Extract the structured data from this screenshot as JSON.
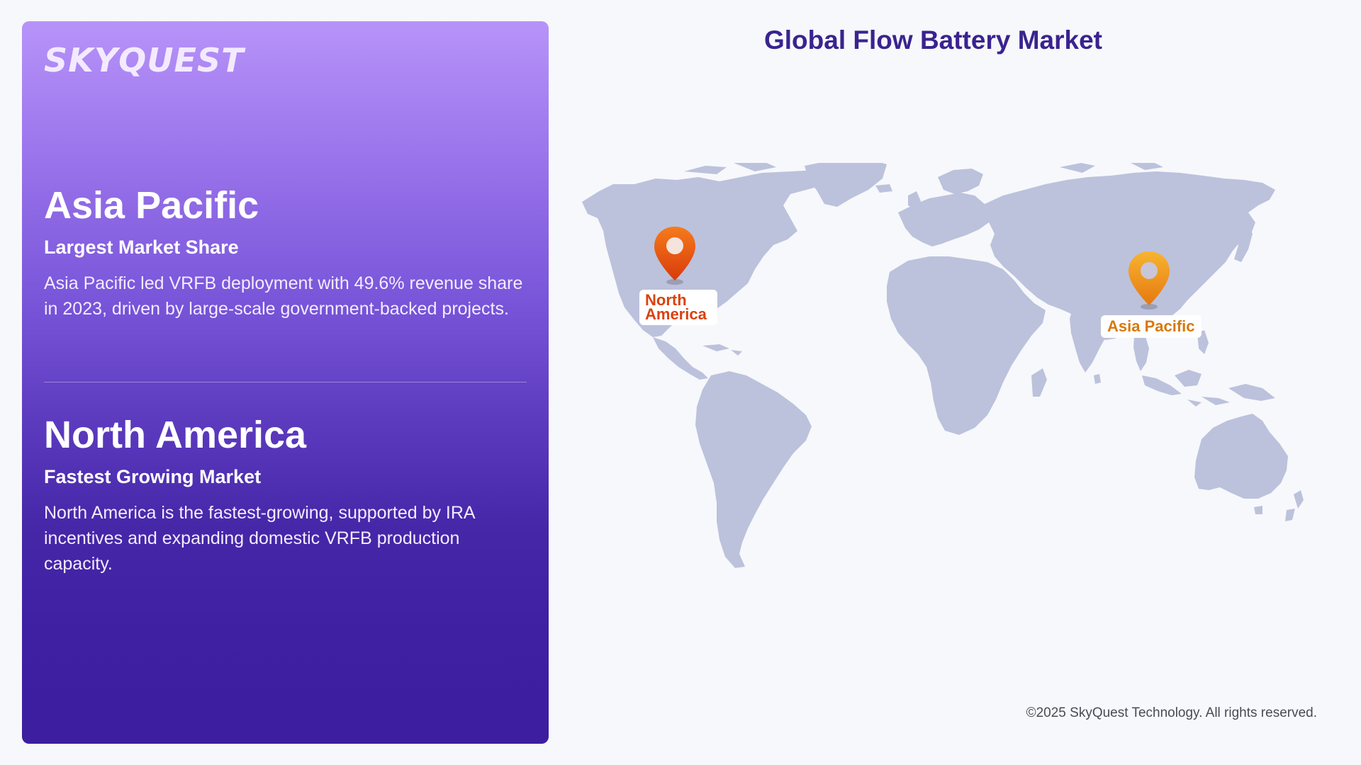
{
  "brand": {
    "logo_text": "SKYQUEST"
  },
  "page": {
    "title": "Global Flow Battery Market",
    "footer": "©2025 SkyQuest Technology. All rights reserved."
  },
  "regions": [
    {
      "name": "Asia Pacific",
      "subtitle": "Largest Market Share",
      "description": "Asia Pacific led VRFB deployment with 49.6% revenue share in 2023, driven by large-scale government-backed projects."
    },
    {
      "name": "North America",
      "subtitle": "Fastest Growing Market",
      "description": "North America is the fastest-growing, supported by IRA incentives and expanding domestic VRFB production capacity."
    }
  ],
  "map": {
    "markers": [
      {
        "label": "North America",
        "icon": "map-pin-icon",
        "color": "#e8560d"
      },
      {
        "label": "Asia Pacific",
        "icon": "map-pin-icon",
        "color": "#f0931a"
      }
    ],
    "land_color": "#bcc2dc"
  },
  "colors": {
    "panel_top": "#b793f9",
    "panel_bottom": "#3d1e9f",
    "title": "#3a238f"
  }
}
